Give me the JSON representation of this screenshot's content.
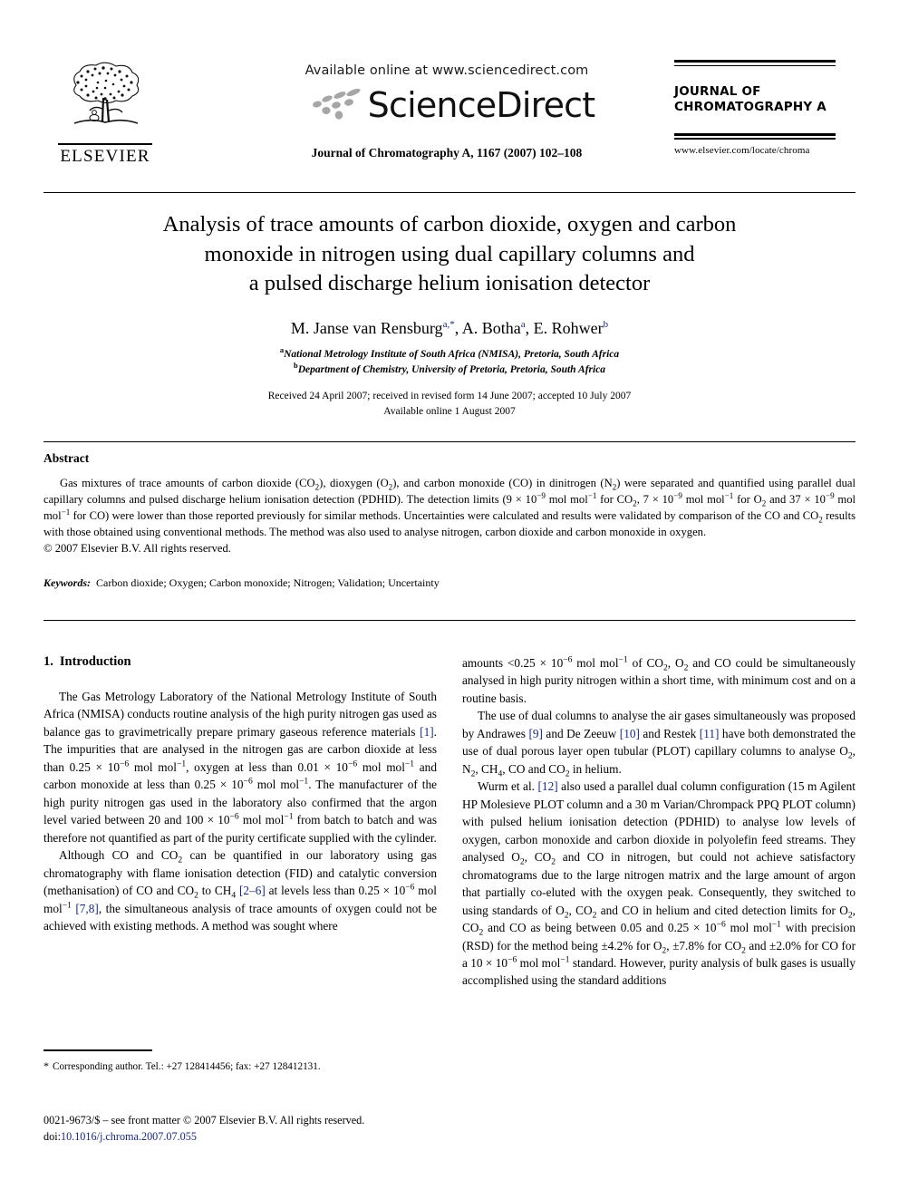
{
  "masthead": {
    "publisher_name": "ELSEVIER",
    "publisher_logo_icon": "elsevier-tree-icon",
    "available_online": "Available online at www.sciencedirect.com",
    "sciencedirect_wordmark": "ScienceDirect",
    "sciencedirect_dots_icon": "sciencedirect-dots-icon",
    "journal_citation": "Journal of Chromatography A, 1167 (2007) 102–108",
    "journal_logo_line1": "JOURNAL OF",
    "journal_logo_line2": "CHROMATOGRAPHY A",
    "journal_url": "www.elsevier.com/locate/chroma"
  },
  "title": {
    "line1": "Analysis of trace amounts of carbon dioxide, oxygen and carbon",
    "line2": "monoxide in nitrogen using dual capillary columns and",
    "line3": "a pulsed discharge helium ionisation detector"
  },
  "authors": {
    "a1_name": "M. Janse van Rensburg",
    "a1_sup": "a,*",
    "sep1": ", ",
    "a2_name": "A. Botha",
    "a2_sup": "a",
    "sep2": ", ",
    "a3_name": "E. Rohwer",
    "a3_sup": "b"
  },
  "affiliations": [
    {
      "marker": "a",
      "text": "National Metrology Institute of South Africa (NMISA), Pretoria, South Africa"
    },
    {
      "marker": "b",
      "text": "Department of Chemistry, University of Pretoria, Pretoria, South Africa"
    }
  ],
  "history": {
    "line1": "Received 24 April 2007; received in revised form 14 June 2007; accepted 10 July 2007",
    "line2": "Available online 1 August 2007"
  },
  "abstract": {
    "heading": "Abstract",
    "p1_part1": "Gas mixtures of trace amounts of carbon dioxide (CO",
    "sub_2a": "2",
    "p1_part2": "), dioxygen (O",
    "sub_2b": "2",
    "p1_part3": "), and carbon monoxide (CO) in dinitrogen (N",
    "sub_2c": "2",
    "p1_part4": ") were separated and quantified using parallel dual capillary columns and pulsed discharge helium ionisation detection (PDHID). The detection limits (9 × 10",
    "sup_m9a": "−9",
    "p1_part5": " mol mol",
    "sup_m1a": "−1",
    "p1_part6": " for CO",
    "sub_2d": "2",
    "p1_part7": ", 7 × 10",
    "sup_m9b": "−9",
    "p1_part8": " mol mol",
    "sup_m1b": "−1",
    "p1_part9": " for O",
    "sub_2e": "2",
    "p1_part10": " and 37 × 10",
    "sup_m9c": "−9",
    "p1_part11": " mol mol",
    "sup_m1c": "−1",
    "p1_part12": " for CO) were lower than those reported previously for similar methods. Uncertainties were calculated and results were validated by comparison of the CO and CO",
    "sub_2f": "2",
    "p1_part13": " results with those obtained using conventional methods. The method was also used to analyse nitrogen, carbon dioxide and carbon monoxide in oxygen.",
    "copyright": "© 2007 Elsevier B.V. All rights reserved."
  },
  "keywords": {
    "label": "Keywords:",
    "value": "Carbon dioxide; Oxygen; Carbon monoxide; Nitrogen; Validation; Uncertainty"
  },
  "introduction": {
    "number": "1.",
    "heading": "Introduction"
  },
  "body_left": {
    "p1_a": "The Gas Metrology Laboratory of the National Metrology Institute of South Africa (NMISA) conducts routine analysis of the high purity nitrogen gas used as balance gas to gravimetrically prepare primary gaseous reference materials ",
    "p1_ref1": "[1]",
    "p1_b": ". The impurities that are analysed in the nitrogen gas are carbon dioxide at less than 0.25 × 10",
    "p1_sup1": "−6",
    "p1_c": " mol mol",
    "p1_sup2": "−1",
    "p1_d": ", oxygen at less than 0.01 × 10",
    "p1_sup3": "−6",
    "p1_e": " mol mol",
    "p1_sup4": "−1",
    "p1_f": " and carbon monoxide at less than 0.25 × 10",
    "p1_sup5": "−6",
    "p1_g": " mol mol",
    "p1_sup6": "−1",
    "p1_h": ". The manufacturer of the high purity nitrogen gas used in the laboratory also confirmed that the argon level varied between 20 and 100 × 10",
    "p1_sup7": "−6",
    "p1_i": " mol mol",
    "p1_sup8": "−1",
    "p1_j": " from batch to batch and was therefore not quantified as part of the purity certificate supplied with the cylinder.",
    "p2_a": "Although CO and CO",
    "p2_sub1": "2",
    "p2_b": " can be quantified in our laboratory using gas chromatography with flame ionisation detection (FID) and catalytic conversion (methanisation) of CO and CO",
    "p2_sub2": "2",
    "p2_c": " to CH",
    "p2_sub3": "4",
    "p2_d": " ",
    "p2_ref1": "[2–6]",
    "p2_e": " at levels less than 0.25 × 10",
    "p2_sup1": "−6",
    "p2_f": " mol mol",
    "p2_sup2": "−1",
    "p2_g": " ",
    "p2_ref2": "[7,8]",
    "p2_h": ", the simultaneous analysis of trace amounts of oxygen could not be achieved with existing methods. A method was sought where"
  },
  "body_right": {
    "p1_a": "amounts <0.25 × 10",
    "p1_sup1": "−6",
    "p1_b": " mol mol",
    "p1_sup2": "−1",
    "p1_c": " of CO",
    "p1_sub1": "2",
    "p1_d": ", O",
    "p1_sub2": "2",
    "p1_e": " and CO could be simultaneously analysed in high purity nitrogen within a short time, with minimum cost and on a routine basis.",
    "p2_a": "The use of dual columns to analyse the air gases simultaneously was proposed by Andrawes ",
    "p2_ref1": "[9]",
    "p2_b": " and De Zeeuw ",
    "p2_ref2": "[10]",
    "p2_c": " and Restek ",
    "p2_ref3": "[11]",
    "p2_d": " have both demonstrated the use of dual porous layer open tubular (PLOT) capillary columns to analyse O",
    "p2_sub1": "2",
    "p2_e": ", N",
    "p2_sub2": "2",
    "p2_f": ", CH",
    "p2_sub3": "4",
    "p2_g": ", CO and CO",
    "p2_sub4": "2",
    "p2_h": " in helium.",
    "p3_a": "Wurm et al. ",
    "p3_ref1": "[12]",
    "p3_b": " also used a parallel dual column configuration (15 m Agilent HP Molesieve PLOT column and a 30 m Varian/Chrompack PPQ PLOT column) with pulsed helium ionisation detection (PDHID) to analyse low levels of oxygen, carbon monoxide and carbon dioxide in polyolefin feed streams. They analysed O",
    "p3_sub1": "2",
    "p3_c": ", CO",
    "p3_sub2": "2",
    "p3_d": " and CO in nitrogen, but could not achieve satisfactory chromatograms due to the large nitrogen matrix and the large amount of argon that partially co-eluted with the oxygen peak. Consequently, they switched to using standards of O",
    "p3_sub3": "2",
    "p3_e": ", CO",
    "p3_sub4": "2",
    "p3_f": " and CO in helium and cited detection limits for O",
    "p3_sub5": "2",
    "p3_g": ", CO",
    "p3_sub6": "2",
    "p3_h": " and CO as being between 0.05 and 0.25 × 10",
    "p3_sup1": "−6",
    "p3_i": " mol mol",
    "p3_sup2": "−1",
    "p3_j": " with precision (RSD) for the method being ±4.2% for O",
    "p3_sub7": "2",
    "p3_k": ", ±7.8% for CO",
    "p3_sub8": "2",
    "p3_l": " and ±2.0% for CO for a 10 × 10",
    "p3_sup3": "−6",
    "p3_m": " mol mol",
    "p3_sup4": "−1",
    "p3_n": " standard. However, purity analysis of bulk gases is usually accomplished using the standard additions"
  },
  "footnote": {
    "star": "*",
    "text": "Corresponding author. Tel.: +27 128414456; fax: +27 128412131."
  },
  "footer": {
    "issn_line": "0021-9673/$ – see front matter © 2007 Elsevier B.V. All rights reserved.",
    "doi_label": "doi:",
    "doi_value": "10.1016/j.chroma.2007.07.055"
  },
  "colors": {
    "text": "#000000",
    "reference_link": "#1a2b6d",
    "sciencedirect_dots": "#a6a6a6"
  }
}
